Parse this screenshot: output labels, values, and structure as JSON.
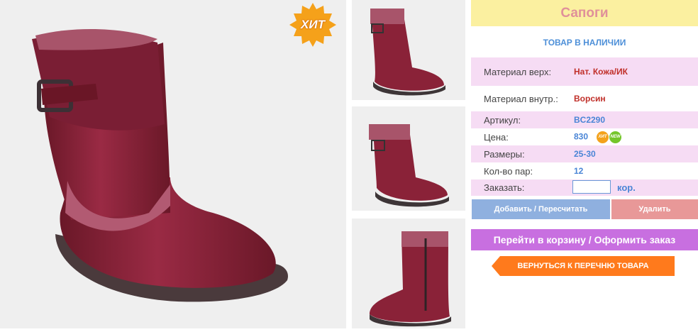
{
  "badge": {
    "label": "ХИТ"
  },
  "product": {
    "title": "Сапоги",
    "stock_status": "ТОВАР В НАЛИЧИИ",
    "specs": [
      {
        "label": "Материал верх:",
        "value": "Нат. Кожа/ИК"
      },
      {
        "label": "Материал внутр.:",
        "value": "Ворсин"
      },
      {
        "label": "Артикул:",
        "value": "BC2290"
      },
      {
        "label": "Цена:",
        "value": "830"
      },
      {
        "label": "Размеры:",
        "value": "25-30"
      },
      {
        "label": "Кол-во пар:",
        "value": "12"
      },
      {
        "label": "Заказать:",
        "value": ""
      }
    ],
    "price_badges": {
      "hit": "ХИТ",
      "new": "NEW"
    },
    "order_unit": "кор."
  },
  "actions": {
    "add": "Добавить / Пересчитать",
    "delete": "Удалить",
    "cart": "Перейти в корзину / Оформить заказ",
    "back": "ВЕРНУТЬСЯ К ПЕРЕЧНЮ ТОВАРА"
  },
  "colors": {
    "boot": "#8a2238",
    "boot_dark": "#5e1424",
    "title_bg": "#fbf0a0",
    "pink_row": "#f6dcf4",
    "blue_button": "#8fb0df",
    "red_button": "#e89898",
    "purple_button": "#c86fe0",
    "orange_button": "#ff7a1c"
  }
}
